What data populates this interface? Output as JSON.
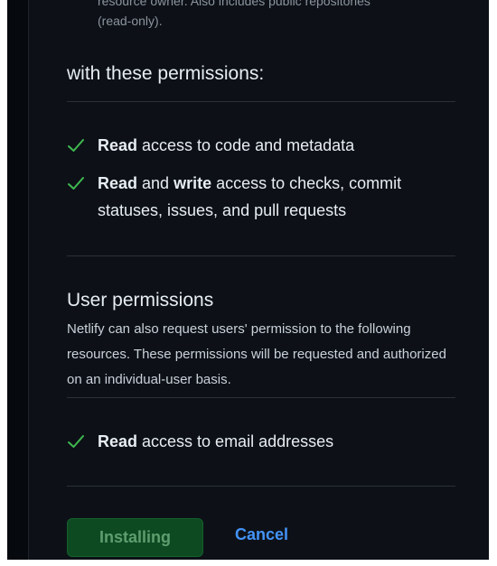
{
  "top_note": {
    "line1": "resource owner. Also includes public repositories",
    "line2": "(read-only)."
  },
  "repo_permissions": {
    "heading": "with these permissions:",
    "items": [
      {
        "bold1": "Read",
        "mid": "",
        "bold2": "",
        "rest": " access to code and metadata"
      },
      {
        "bold1": "Read",
        "mid": " and ",
        "bold2": "write",
        "rest": " access to checks, commit statuses, issues, and pull requests"
      }
    ]
  },
  "user_permissions": {
    "heading": "User permissions",
    "description": "Netlify can also request users' permission to the following resources. These permissions will be requested and authorized on an individual-user basis.",
    "items": [
      {
        "bold1": "Read",
        "rest": " access to email addresses"
      }
    ]
  },
  "actions": {
    "install_label": "Installing",
    "cancel_label": "Cancel"
  },
  "colors": {
    "check": "#3fb950",
    "link": "#4493f8",
    "install_bg": "#0e4a21"
  },
  "icons": {
    "check": "check-icon"
  }
}
